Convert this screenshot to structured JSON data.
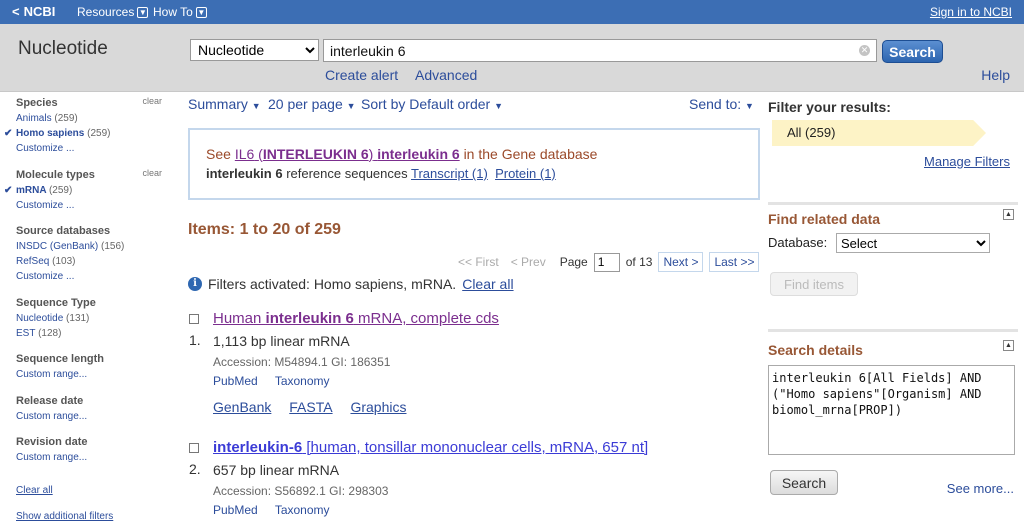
{
  "topbar": {
    "logo": "NCBI",
    "resources": "Resources",
    "howto": "How To",
    "signin": "Sign in to NCBI"
  },
  "header": {
    "db_title": "Nucleotide",
    "db_select": "Nucleotide",
    "query": "interleukin 6",
    "search_label": "Search",
    "create_alert": "Create alert",
    "advanced": "Advanced",
    "help": "Help"
  },
  "sidebar": {
    "species": {
      "heading": "Species",
      "clear": "clear",
      "items": [
        {
          "label": "Animals",
          "count": "(259)"
        },
        {
          "label": "Homo sapiens",
          "count": "(259)"
        }
      ],
      "customize": "Customize ..."
    },
    "molecule": {
      "heading": "Molecule types",
      "clear": "clear",
      "items": [
        {
          "label": "mRNA",
          "count": "(259)"
        }
      ],
      "customize": "Customize ..."
    },
    "source": {
      "heading": "Source databases",
      "items": [
        {
          "label": "INSDC (GenBank)",
          "count": "(156)"
        },
        {
          "label": "RefSeq",
          "count": "(103)"
        }
      ],
      "customize": "Customize ..."
    },
    "seqtype": {
      "heading": "Sequence Type",
      "items": [
        {
          "label": "Nucleotide",
          "count": "(131)"
        },
        {
          "label": "EST",
          "count": "(128)"
        }
      ]
    },
    "seqlen": {
      "heading": "Sequence length",
      "custom": "Custom range..."
    },
    "release": {
      "heading": "Release date",
      "custom": "Custom range..."
    },
    "revision": {
      "heading": "Revision date",
      "custom": "Custom range..."
    },
    "clear_all": "Clear all",
    "show_additional": "Show additional filters"
  },
  "toolbar": {
    "summary": "Summary",
    "per_page": "20 per page",
    "sort": "Sort by Default order",
    "send_to": "Send to:"
  },
  "genebox": {
    "see": "See",
    "il6": "IL6",
    "paren_open": "(",
    "sym": "INTERLEUKIN 6",
    "paren_close": ")",
    "name": "interleukin 6",
    "in_gene": "in the Gene database",
    "ref_bold": "interleukin 6",
    "ref_text": "reference sequences",
    "transcript": "Transcript (1)",
    "protein": "Protein (1)"
  },
  "items_label": "Items: 1 to 20 of 259",
  "pager": {
    "first": "<< First",
    "prev": "< Prev",
    "page_label": "Page",
    "page_value": "1",
    "of": "of 13",
    "next": "Next >",
    "last": "Last >>"
  },
  "filters": {
    "text": "Filters activated: Homo sapiens, mRNA.",
    "clear_all": "Clear all"
  },
  "results": [
    {
      "num": "1.",
      "title_pre": "Human ",
      "title_bold": "interleukin 6",
      "title_post": " mRNA, complete cds",
      "desc": "1,113 bp linear mRNA",
      "accession": "Accession: M54894.1   GI: 186351",
      "pubmed": "PubMed",
      "taxonomy": "Taxonomy",
      "genbank": "GenBank",
      "fasta": "FASTA",
      "graphics": "Graphics"
    },
    {
      "num": "2.",
      "title_bold": "interleukin-6",
      "title_post": " [human, tonsillar mononuclear cells, mRNA, 657 nt]",
      "desc": "657 bp linear mRNA",
      "accession": "Accession: S56892.1   GI: 298303",
      "pubmed": "PubMed",
      "taxonomy": "Taxonomy"
    }
  ],
  "right": {
    "filter_title": "Filter your results:",
    "all": "All (259)",
    "manage": "Manage Filters",
    "related_title": "Find related data",
    "database_label": "Database:",
    "database_value": "Select",
    "find_items": "Find items",
    "details_title": "Search details",
    "details_text": "interleukin 6[All Fields] AND (\"Homo sapiens\"[Organism] AND biomol_mrna[PROP])",
    "search_btn": "Search",
    "see_more": "See more..."
  }
}
